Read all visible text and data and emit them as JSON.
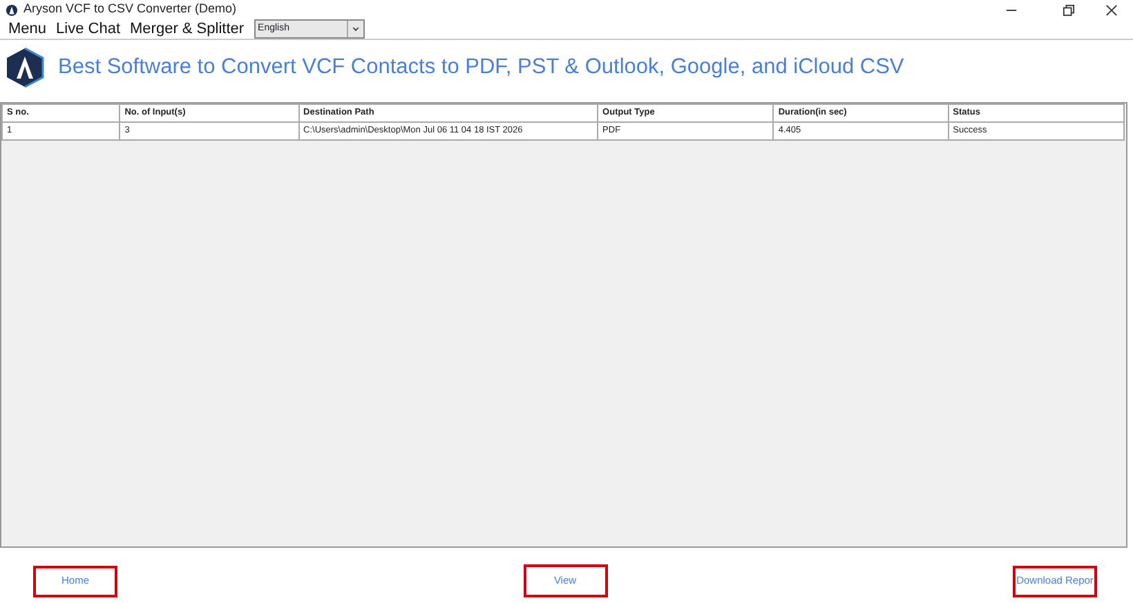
{
  "window": {
    "title": "Aryson VCF to CSV Converter (Demo)"
  },
  "menu": [
    "Menu",
    "Live Chat",
    "Merger & Splitter"
  ],
  "language": {
    "value": "English"
  },
  "header": {
    "title": "Best Software to Convert VCF Contacts to PDF, PST & Outlook, Google, and iCloud CSV"
  },
  "table": {
    "columns": [
      "S no.",
      "No. of Input(s)",
      "Destination Path",
      "Output Type",
      "Duration(in sec)",
      "Status"
    ],
    "rows": [
      [
        "1",
        "3",
        "C:\\Users\\admin\\Desktop\\Mon Jul 06 11 04 18 IST 2026",
        "PDF",
        "4.405",
        "Success"
      ]
    ]
  },
  "buttons": [
    "Home",
    "View",
    "Download Repor"
  ]
}
